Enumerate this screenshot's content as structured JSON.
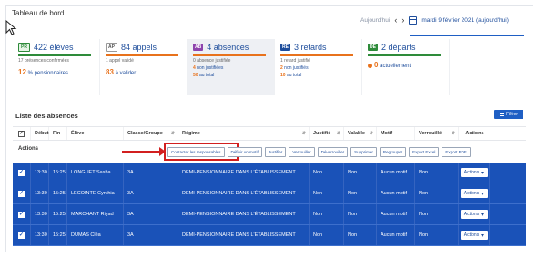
{
  "header": {
    "title": "Tableau de bord",
    "today_label": "Aujourd'hui",
    "date": "mardi 9 février 2021 (aujourd'hui)"
  },
  "cards": [
    {
      "badge": "PR",
      "value": "422 élèves",
      "bar_color": "#2e8b3a",
      "sub": "17 présences confirmées",
      "line2_num": "12",
      "line2_text": "% pensionnaires"
    },
    {
      "badge": "AP",
      "value": "84 appels",
      "bar_color": "#e8721c",
      "sub": "1 appel validé",
      "line2_num": "83",
      "line2_text": "à valider"
    },
    {
      "badge": "AB",
      "value": "4 absences",
      "bar_color": "#e8721c",
      "sub": "0 absence justifiée",
      "line2_num": "4",
      "line2_text": "non justifiées",
      "line3_num": "50",
      "line3_text": "au total"
    },
    {
      "badge": "RE",
      "value": "3 retards",
      "bar_color": "#e8721c",
      "sub": "1 retard justifié",
      "line2_num": "2",
      "line2_text": "non justifiés",
      "line3_num": "10",
      "line3_text": "au total"
    },
    {
      "badge": "DE",
      "value": "2 départs",
      "bar_color": "#2e8b3a",
      "sub": "",
      "line2_num": "0",
      "line2_text": "actuellement"
    }
  ],
  "list": {
    "title": "Liste des absences",
    "filter_label": "Filtrer"
  },
  "table": {
    "columns": [
      "Début",
      "Fin",
      "Élève",
      "Classe/Groupe",
      "Régime",
      "Justifié",
      "Valable",
      "Motif",
      "Verrouillé",
      "Actions"
    ],
    "actions_label": "Actions",
    "action_buttons": [
      "Contacter les responsables",
      "Définir un motif",
      "Justifier",
      "Verrouiller",
      "Déverrouiller",
      "Supprimer",
      "Regrouper",
      "Export Excel",
      "Export PDF"
    ],
    "rows": [
      {
        "debut": "13:30",
        "fin": "15:25",
        "eleve": "LONGUET Sasha",
        "classe": "3A",
        "regime": "DEMI-PENSIONNAIRE DANS L'ÉTABLISSEMENT",
        "justifie": "Non",
        "valable": "Non",
        "motif": "Aucun motif",
        "verrouille": "Non",
        "action": "Actions"
      },
      {
        "debut": "13:30",
        "fin": "15:25",
        "eleve": "LECOINTE Cynthia",
        "classe": "3A",
        "regime": "DEMI-PENSIONNAIRE DANS L'ÉTABLISSEMENT",
        "justifie": "Non",
        "valable": "Non",
        "motif": "Aucun motif",
        "verrouille": "Non",
        "action": "Actions"
      },
      {
        "debut": "13:30",
        "fin": "15:25",
        "eleve": "MARCHANT Riyad",
        "classe": "3A",
        "regime": "DEMI-PENSIONNAIRE DANS L'ÉTABLISSEMENT",
        "justifie": "Non",
        "valable": "Non",
        "motif": "Aucun motif",
        "verrouille": "Non",
        "action": "Actions"
      },
      {
        "debut": "13:30",
        "fin": "15:25",
        "eleve": "DUMAS Cléa",
        "classe": "3A",
        "regime": "DEMI-PENSIONNAIRE DANS L'ÉTABLISSEMENT",
        "justifie": "Non",
        "valable": "Non",
        "motif": "Aucun motif",
        "verrouille": "Non",
        "action": "Actions"
      }
    ]
  }
}
